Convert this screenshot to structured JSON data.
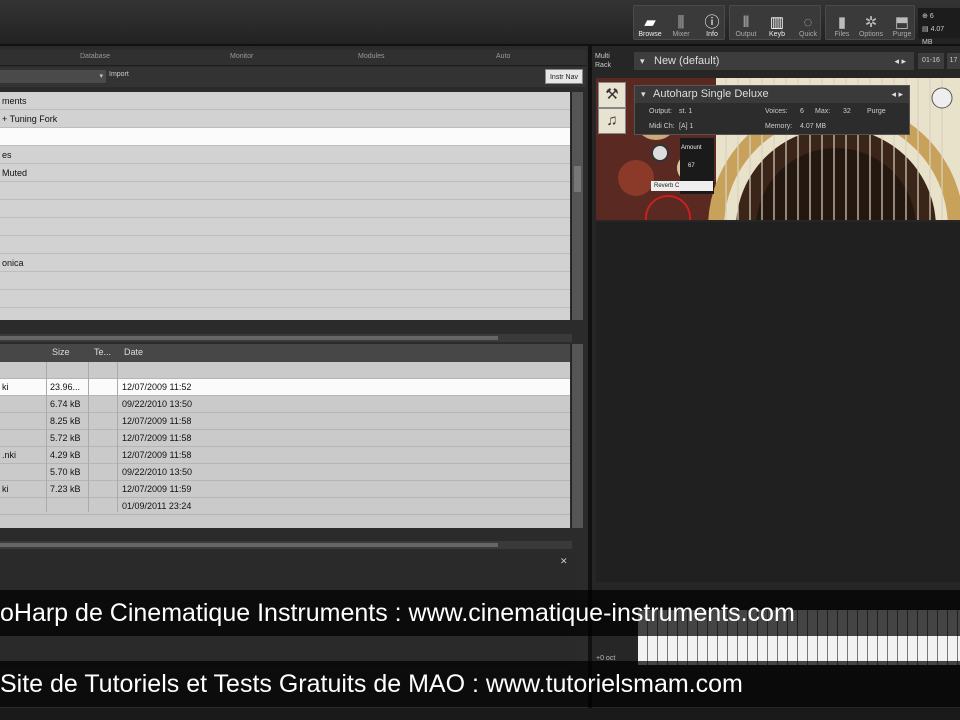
{
  "toolbar": {
    "buttons": [
      {
        "label": "Browse",
        "icon": "folder-icon",
        "active": true
      },
      {
        "label": "Mixer",
        "icon": "mixer-icon",
        "active": false
      },
      {
        "label": "Info",
        "icon": "info-icon",
        "active": true
      },
      {
        "label": "Output",
        "icon": "output-icon",
        "active": false
      },
      {
        "label": "Keyb",
        "icon": "keyboard-icon",
        "active": true
      },
      {
        "label": "Quick",
        "icon": "quick-icon",
        "active": false
      },
      {
        "label": "Files",
        "icon": "files-icon",
        "active": false
      },
      {
        "label": "Options",
        "icon": "options-icon",
        "active": false
      },
      {
        "label": "Purge",
        "icon": "purge-icon",
        "active": false
      }
    ],
    "voices": "6",
    "memory": "4.07 MB"
  },
  "browser": {
    "tabs": [
      "Database",
      "Monitor",
      "Modules",
      "Auto"
    ],
    "import_label": "Import",
    "instr_nav_label": "Instr Nav",
    "folders": [
      {
        "label": "ments",
        "selected": false
      },
      {
        "label": "+ Tuning Fork",
        "selected": false
      },
      {
        "label": "",
        "selected": true
      },
      {
        "label": "es",
        "selected": false
      },
      {
        "label": "Muted",
        "selected": false
      },
      {
        "label": "",
        "selected": false
      },
      {
        "label": "",
        "selected": false
      },
      {
        "label": "",
        "selected": false
      },
      {
        "label": "",
        "selected": false
      },
      {
        "label": "onica",
        "selected": false
      },
      {
        "label": "",
        "selected": false
      },
      {
        "label": "",
        "selected": false
      }
    ],
    "file_columns": [
      "Size",
      "Te...",
      "Date"
    ],
    "files": [
      {
        "name": "",
        "size": "",
        "date": "",
        "selected": false
      },
      {
        "name": "ki",
        "size": "23.96...",
        "date": "12/07/2009 11:52",
        "selected": true
      },
      {
        "name": "",
        "size": "6.74 kB",
        "date": "09/22/2010 13:50",
        "selected": false
      },
      {
        "name": "",
        "size": "8.25 kB",
        "date": "12/07/2009 11:58",
        "selected": false
      },
      {
        "name": "",
        "size": "5.72 kB",
        "date": "12/07/2009 11:58",
        "selected": false
      },
      {
        "name": ".nki",
        "size": "4.29 kB",
        "date": "12/07/2009 11:58",
        "selected": false
      },
      {
        "name": "",
        "size": "5.70 kB",
        "date": "09/22/2010 13:50",
        "selected": false
      },
      {
        "name": "ki",
        "size": "7.23 kB",
        "date": "12/07/2009 11:59",
        "selected": false
      },
      {
        "name": "",
        "size": "",
        "date": "01/09/2011 23:24",
        "selected": false
      },
      {
        "name": "",
        "size": "",
        "date": "",
        "selected": false
      }
    ]
  },
  "rack": {
    "title_line1": "Multi",
    "title_line2": "Rack",
    "preset": "New (default)",
    "page_a": "01-16",
    "page_b": "17"
  },
  "instrument": {
    "name": "Autoharp Single Deluxe",
    "output_label": "Output:",
    "output_value": "st. 1",
    "voices_label": "Voices:",
    "voices_value": "6",
    "max_label": "Max:",
    "max_value": "32",
    "purge_label": "Purge",
    "midi_label": "Midi Ch:",
    "midi_value": "[A] 1",
    "memory_label": "Memory:",
    "memory_value": "4.07 MB"
  },
  "knob": {
    "label": "Amount",
    "value": "67",
    "reverb_label": "Reverb C"
  },
  "keyboard": {
    "label": "+0 oct"
  },
  "captions": {
    "line1": "oHarp de Cinematique Instruments : www.cinematique-instruments.com",
    "line2": "Site de Tutoriels et Tests Gratuits de MAO : www.tutorielsmam.com"
  }
}
